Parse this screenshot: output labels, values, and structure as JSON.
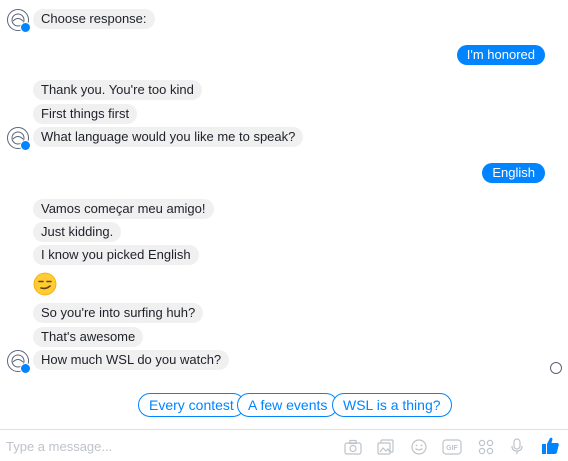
{
  "messages": {
    "bot_prompt": "Choose response:",
    "user_reply_1": "I'm honored",
    "bot_group_1": [
      "Thank you. You're too kind",
      "First things first",
      "What language would you like me to speak?"
    ],
    "user_reply_2": "English",
    "bot_group_2": [
      "Vamos começar meu amigo!",
      "Just kidding.",
      "I know you picked English"
    ],
    "bot_group_3": [
      "So you're into surfing huh?",
      "That's awesome",
      "How much WSL do you watch?"
    ]
  },
  "quick_replies": [
    "Every contest",
    "A few events",
    "WSL is a thing?"
  ],
  "composer": {
    "placeholder": "Type a message...",
    "icons": [
      "camera-icon",
      "gallery-icon",
      "emoji-icon",
      "gif-icon",
      "apps-icon",
      "microphone-icon",
      "thumbs-up-icon"
    ]
  },
  "colors": {
    "accent": "#0084ff",
    "bubble": "#f1f0f0",
    "icon": "#5b6577"
  }
}
